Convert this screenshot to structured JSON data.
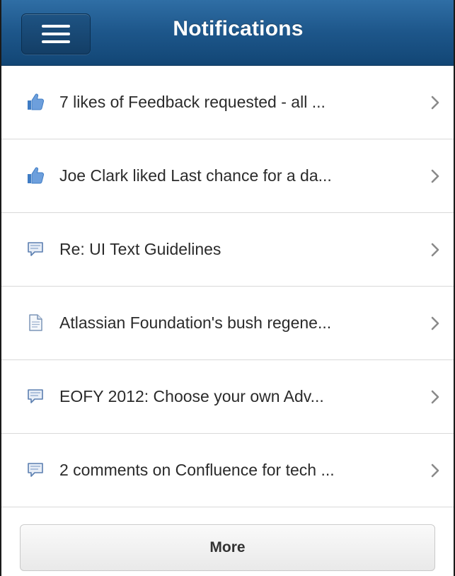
{
  "header": {
    "title": "Notifications",
    "menu_icon": "hamburger-menu-icon"
  },
  "notifications": [
    {
      "icon": "thumbs-up-icon",
      "text": "7 likes of Feedback requested - all ..."
    },
    {
      "icon": "thumbs-up-icon",
      "text": "Joe Clark liked Last chance for a da..."
    },
    {
      "icon": "comment-icon",
      "text": "Re: UI Text Guidelines"
    },
    {
      "icon": "page-icon",
      "text": "Atlassian Foundation's bush regene..."
    },
    {
      "icon": "comment-icon",
      "text": "EOFY 2012: Choose your own Adv..."
    },
    {
      "icon": "comment-icon",
      "text": "2 comments on Confluence for tech ..."
    }
  ],
  "footer": {
    "more_label": "More"
  },
  "colors": {
    "header_top": "#2f6ea5",
    "header_bottom": "#124675",
    "icon_blue": "#3f7cc4",
    "divider": "#d9d9d9"
  }
}
